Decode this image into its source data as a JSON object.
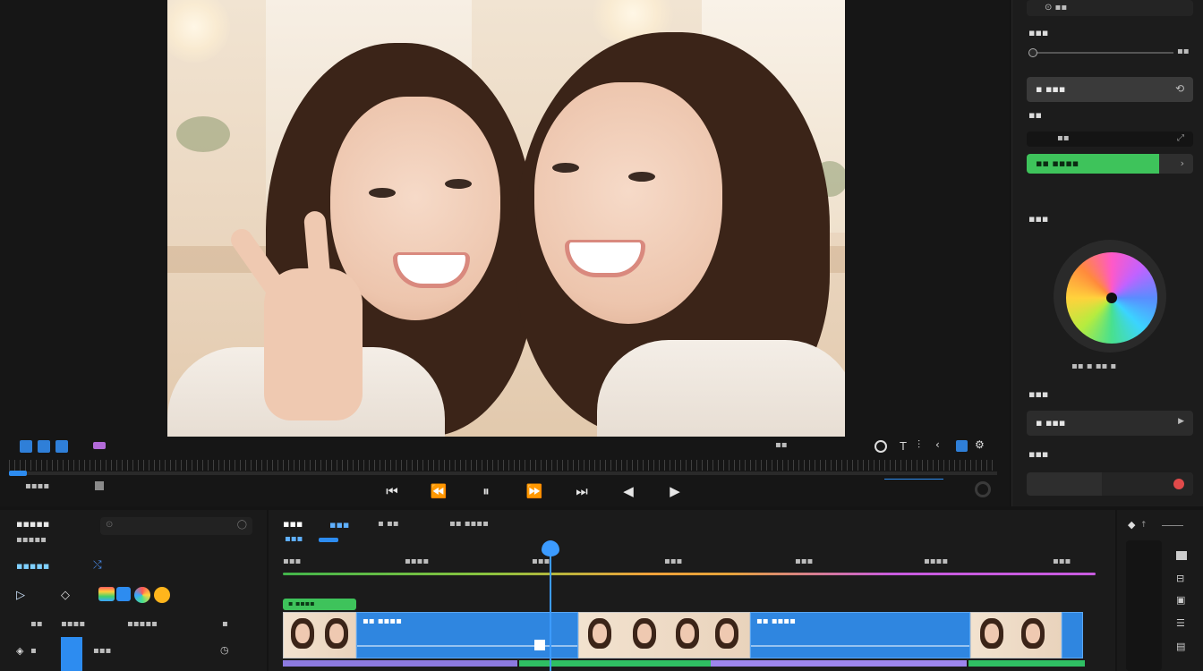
{
  "preview": {
    "toolbar_left_label": "▪ ▪",
    "toolbar_right_label": "▪▪",
    "transport_hint": "▪▪▪▪",
    "controls": [
      "⏮",
      "⏪",
      "⏸",
      "⏩",
      "⏭",
      "◀",
      "▶"
    ]
  },
  "inspector": {
    "top_field_value": "⊙ ▪▪",
    "section1_title": "▪▪▪",
    "slider_value": "▪▪",
    "preset_button": "▪ ▪▪▪",
    "section2_title": "▪▪",
    "field_value": "▪▪",
    "apply_button": "▪▪ ▪▪▪▪",
    "color_section_title": "▪▪▪",
    "wheel_caption": "▪▪ ▪ ▪▪ ▪",
    "section3_title": "▪▪▪",
    "dropdown_label": "▪ ▪▪▪",
    "section4_title": "▪▪▪",
    "accent_color": "#2d8cf0",
    "green_color": "#3ec35b"
  },
  "media": {
    "title": "▪▪▪▪▪",
    "subtitle": "▪▪▪▪▪",
    "search_placeholder": "",
    "section_title": "▪▪▪▪▪",
    "tabs": [
      "▪▪",
      "▪▪▪▪",
      "▪▪▪▪▪",
      "▪"
    ],
    "item_label": "▪▪▪"
  },
  "timeline": {
    "header_tabs": [
      "▪▪▪",
      "▪▪▪",
      "▪ ▪▪",
      "▪▪ ▪▪▪▪"
    ],
    "active_sub": "▪▪▪",
    "ruler": [
      "▪▪▪",
      "▪▪▪▪",
      "▪▪▪",
      "▪▪▪",
      "▪▪▪",
      "▪▪▪▪",
      "▪▪▪"
    ],
    "clip_labels": [
      "▪▪ ▪▪▪▪",
      "▪▪ ▪▪▪▪"
    ],
    "green_tag": "▪ ▪▪▪▪"
  }
}
